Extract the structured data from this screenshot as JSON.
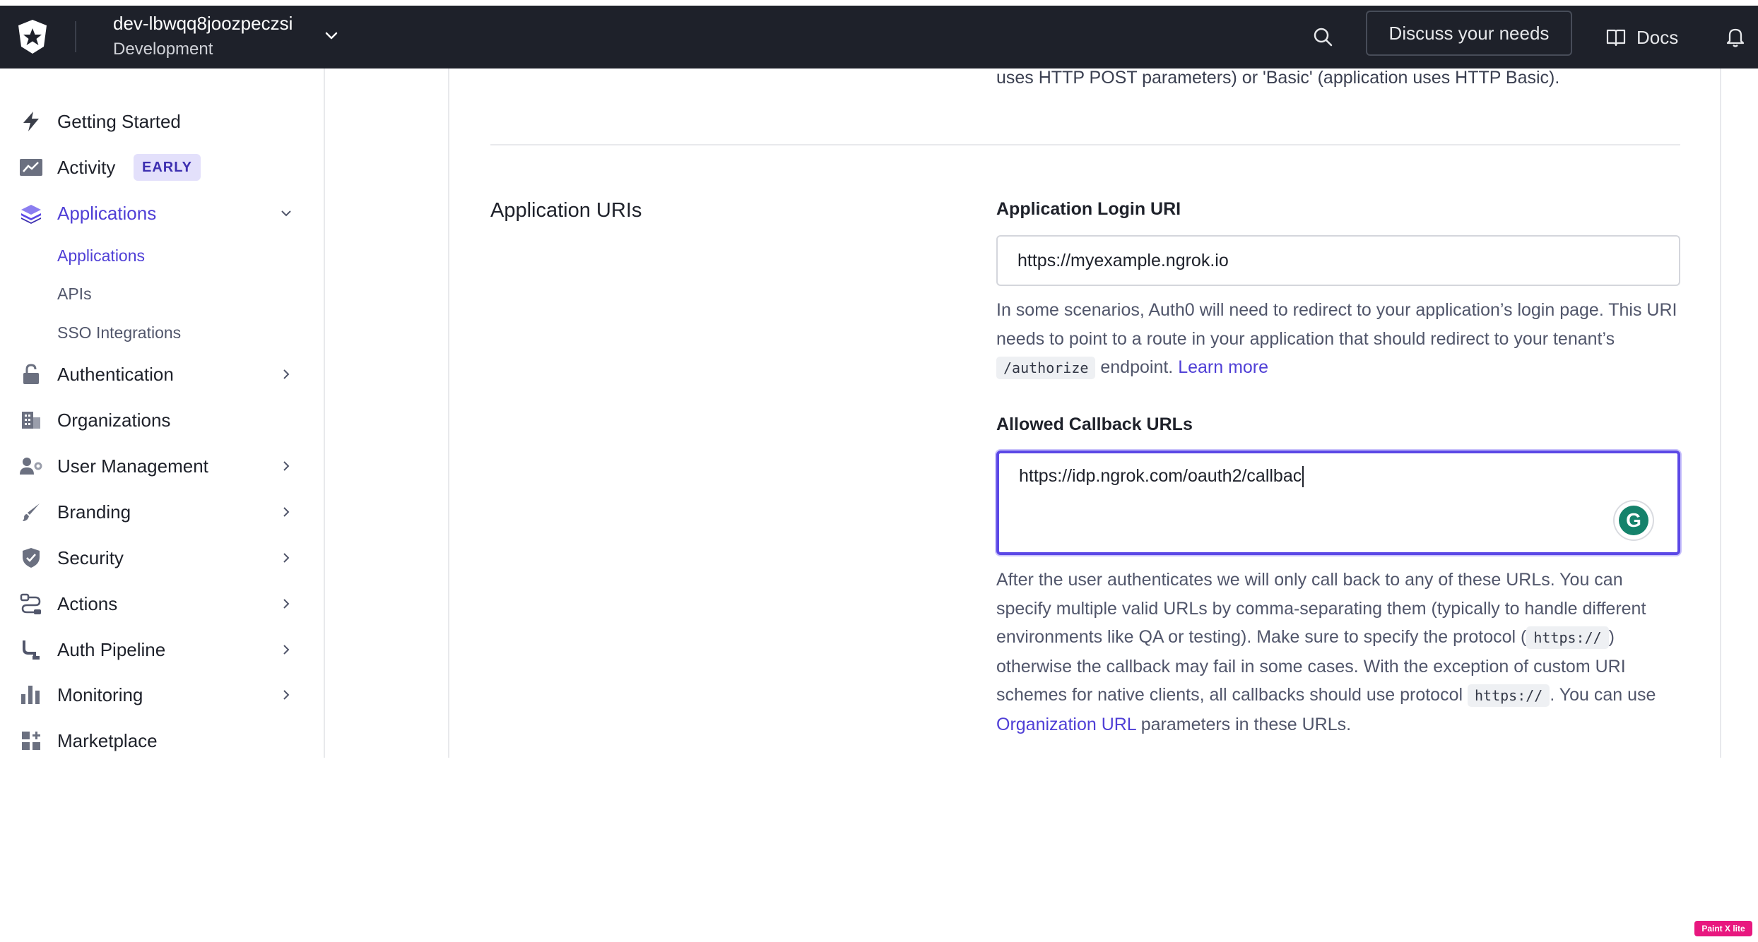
{
  "topbar": {
    "tenant_name": "dev-lbwqq8joozpeczsi",
    "tenant_env": "Development",
    "discuss_label": "Discuss your needs",
    "docs_label": "Docs"
  },
  "sidebar": {
    "items": [
      {
        "label": "Getting Started",
        "icon": "lightning-icon"
      },
      {
        "label": "Activity",
        "icon": "activity-chart-icon",
        "badge": "EARLY"
      },
      {
        "label": "Applications",
        "icon": "layers-icon",
        "active": true
      },
      {
        "label": "Authentication",
        "icon": "lock-icon"
      },
      {
        "label": "Organizations",
        "icon": "building-icon"
      },
      {
        "label": "User Management",
        "icon": "users-gear-icon"
      },
      {
        "label": "Branding",
        "icon": "brush-icon"
      },
      {
        "label": "Security",
        "icon": "shield-icon"
      },
      {
        "label": "Actions",
        "icon": "actions-flow-icon"
      },
      {
        "label": "Auth Pipeline",
        "icon": "pipeline-icon"
      },
      {
        "label": "Monitoring",
        "icon": "bar-chart-icon"
      },
      {
        "label": "Marketplace",
        "icon": "marketplace-grid-icon"
      }
    ],
    "sub_items": [
      {
        "label": "Applications",
        "active": true
      },
      {
        "label": "APIs"
      },
      {
        "label": "SSO Integrations"
      }
    ]
  },
  "main": {
    "prev_help_text": "uses HTTP POST parameters) or 'Basic' (application uses HTTP Basic).",
    "section_title": "Application URIs",
    "login_uri": {
      "label": "Application Login URI",
      "value": "https://myexample.ngrok.io",
      "help_1": "In some scenarios, Auth0 will need to redirect to your application’s login page. This URI needs to point to a route in your application that should redirect to your tenant’s ",
      "help_code": "/authorize",
      "help_2": " endpoint. ",
      "help_link": "Learn more"
    },
    "callback": {
      "label": "Allowed Callback URLs",
      "value": "https://idp.ngrok.com/oauth2/callbac",
      "help_1": "After the user authenticates we will only call back to any of these URLs. You can specify multiple valid URLs by comma-separating them (typically to handle different environments like QA or testing). Make sure to specify the protocol (",
      "help_code_1": "https://",
      "help_2": ") otherwise the callback may fail in some cases. With the exception of custom URI schemes for native clients, all callbacks should use protocol ",
      "help_code_2": "https://",
      "help_3": ". You can use ",
      "help_link": "Organization URL",
      "help_4": " parameters in these URLs."
    },
    "grammarly_letter": "G"
  },
  "watermark": "Paint X lite"
}
